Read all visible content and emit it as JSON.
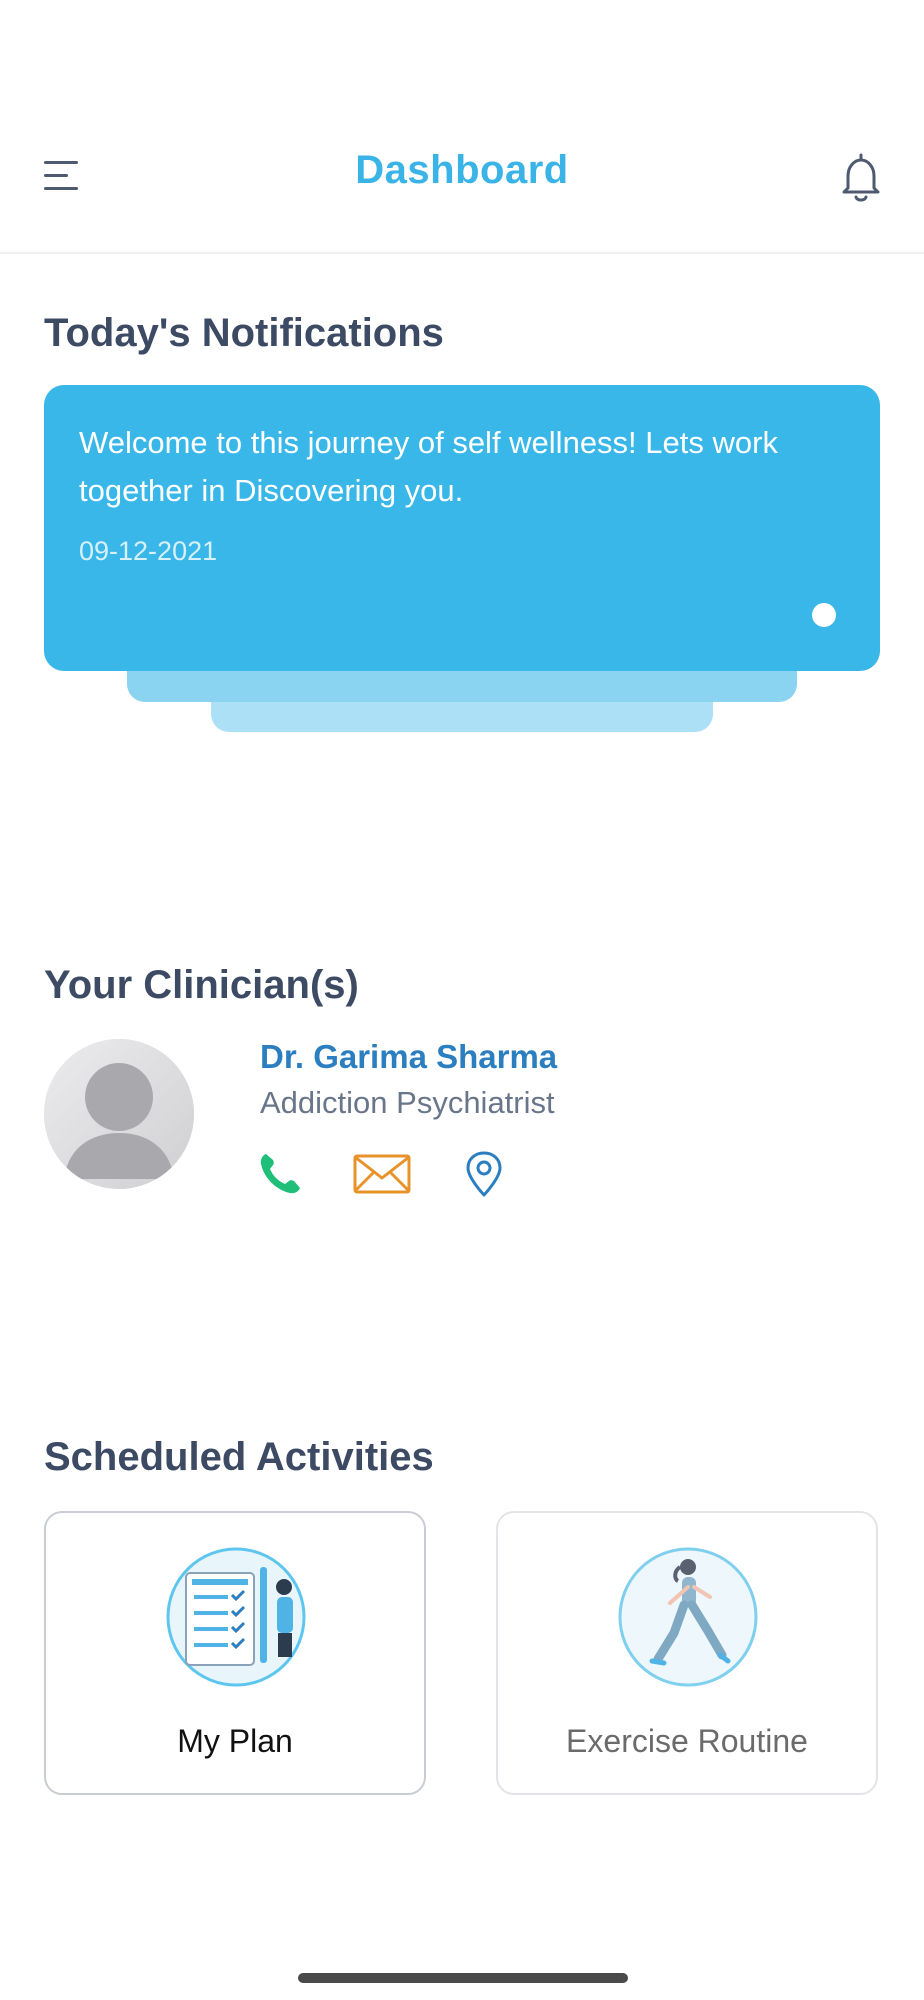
{
  "header": {
    "title": "Dashboard",
    "menu_icon": "hamburger-menu-icon",
    "bell_icon": "bell-icon"
  },
  "notifications": {
    "section_title": "Today's Notifications",
    "items": [
      {
        "message": "Welcome to this journey of self wellness! Lets work together in Discovering you.",
        "date": "09-12-2021"
      }
    ]
  },
  "clinicians": {
    "section_title": "Your Clinician(s)",
    "items": [
      {
        "name": "Dr. Garima Sharma",
        "role": "Addiction Psychiatrist",
        "actions": [
          "phone-icon",
          "email-icon",
          "location-pin-icon"
        ]
      }
    ]
  },
  "activities": {
    "section_title": "Scheduled Activities",
    "items": [
      {
        "label": "My Plan",
        "icon": "checklist-plan-icon"
      },
      {
        "label": "Exercise Routine",
        "icon": "exercise-running-icon"
      }
    ]
  },
  "colors": {
    "accent": "#3ab3e6",
    "card_blue": "#38b7e8",
    "heading": "#3d4a63",
    "clinician_name": "#2b7fc0",
    "phone": "#1fbf7a",
    "email": "#e8922a",
    "location": "#2b7fc0"
  }
}
